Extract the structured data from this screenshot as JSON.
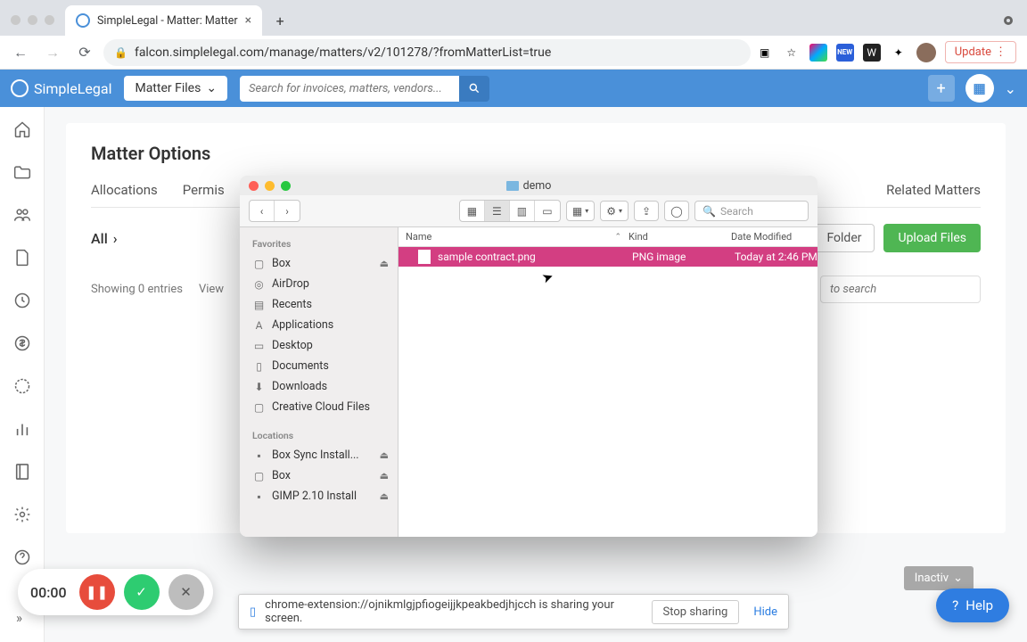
{
  "browser": {
    "tab_title": "SimpleLegal - Matter: Matter",
    "url": "falcon.simplelegal.com/manage/matters/v2/101278/?fromMatterList=true",
    "update_label": "Update"
  },
  "header": {
    "brand": "SimpleLegal",
    "dropdown_label": "Matter Files",
    "search_placeholder": "Search for invoices, matters, vendors..."
  },
  "page": {
    "title": "Matter Options",
    "tabs": {
      "allocations": "Allocations",
      "permissions": "Permis",
      "related": "Related Matters"
    },
    "all_label": "All",
    "add_folder_label": "Folder",
    "upload_label": "Upload Files",
    "showing": "Showing 0 entries",
    "view_label": "View",
    "search_placeholder": "to search",
    "inactive_label": "Inactiv"
  },
  "finder": {
    "title": "demo",
    "search_placeholder": "Search",
    "sidebar": {
      "favorites_head": "Favorites",
      "favorites": [
        "Box",
        "AirDrop",
        "Recents",
        "Applications",
        "Desktop",
        "Documents",
        "Downloads",
        "Creative Cloud Files"
      ],
      "locations_head": "Locations",
      "locations": [
        "Box Sync Install...",
        "Box",
        "GIMP 2.10 Install"
      ]
    },
    "columns": {
      "name": "Name",
      "kind": "Kind",
      "date": "Date Modified"
    },
    "file": {
      "name": "sample contract.png",
      "kind": "PNG image",
      "date": "Today at 2:46 PM"
    }
  },
  "recorder": {
    "time": "00:00"
  },
  "share": {
    "text": "chrome-extension://ojnikmlgjpfiogeijjkpeakbedjhjcch is sharing your screen.",
    "stop": "Stop sharing",
    "hide": "Hide"
  },
  "help": {
    "label": "Help"
  }
}
